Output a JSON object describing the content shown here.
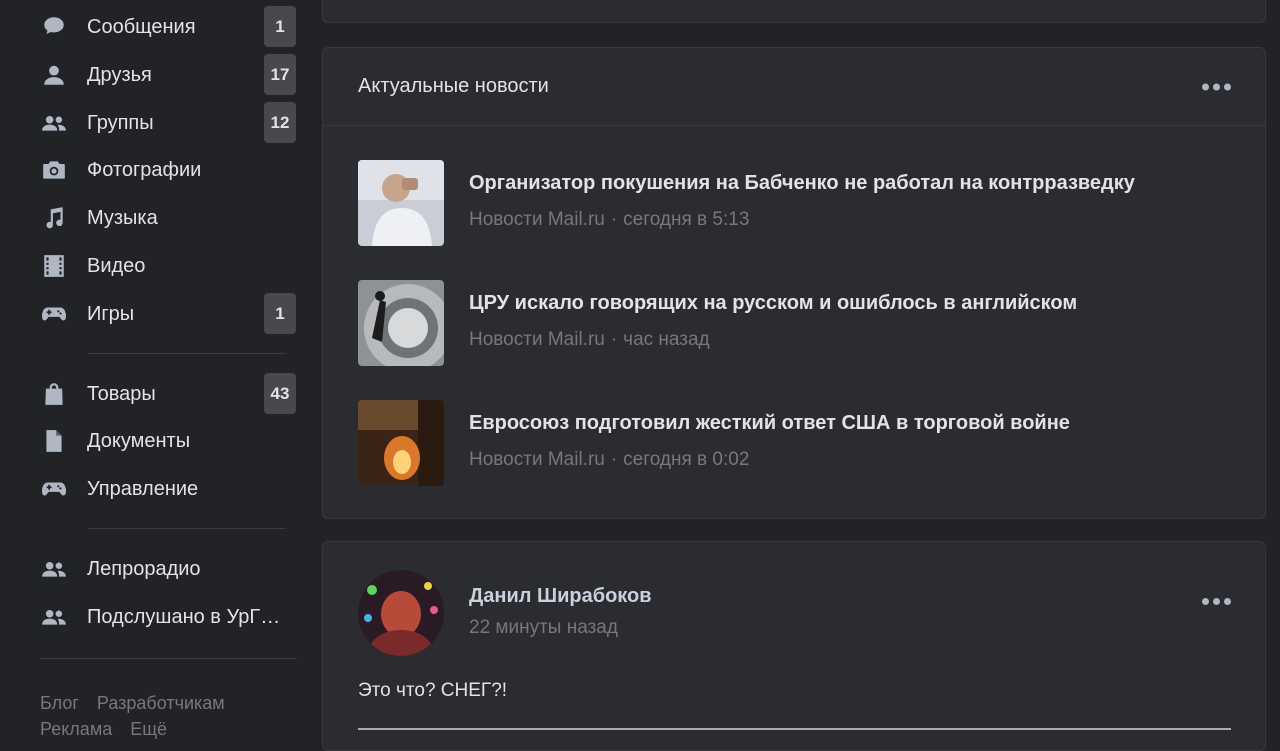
{
  "sidebar": {
    "items": [
      {
        "icon": "message-icon",
        "label": "Сообщения",
        "badge": "1"
      },
      {
        "icon": "user-icon",
        "label": "Друзья",
        "badge": "17"
      },
      {
        "icon": "users-icon",
        "label": "Группы",
        "badge": "12"
      },
      {
        "icon": "camera-icon",
        "label": "Фотографии",
        "badge": ""
      },
      {
        "icon": "music-icon",
        "label": "Музыка",
        "badge": ""
      },
      {
        "icon": "video-icon",
        "label": "Видео",
        "badge": ""
      },
      {
        "icon": "gamepad-icon",
        "label": "Игры",
        "badge": "1"
      },
      {
        "icon": "bag-icon",
        "label": "Товары",
        "badge": "43"
      },
      {
        "icon": "document-icon",
        "label": "Документы",
        "badge": ""
      },
      {
        "icon": "gamepad-icon",
        "label": "Управление",
        "badge": ""
      },
      {
        "icon": "users-icon",
        "label": "Лепрорадио",
        "badge": ""
      },
      {
        "icon": "users-icon",
        "label": "Подслушано в УрГ…",
        "badge": ""
      }
    ],
    "footer": [
      "Блог",
      "Разработчикам",
      "Реклама",
      "Ещё"
    ]
  },
  "news_card": {
    "title": "Актуальные новости",
    "items": [
      {
        "title": "Организатор покушения на Бабченко не работал на контрразведку",
        "source": "Новости Mail.ru",
        "time": "сегодня в 5:13"
      },
      {
        "title": "ЦРУ искало говорящих на русском и ошиблось в английском",
        "source": "Новости Mail.ru",
        "time": "час назад"
      },
      {
        "title": "Евросоюз подготовил жесткий ответ США в торговой войне",
        "source": "Новости Mail.ru",
        "time": "сегодня в 0:02"
      }
    ]
  },
  "post": {
    "author": "Данил Ширабоков",
    "time": "22 минуты назад",
    "text": "Это что? СНЕГ?!"
  },
  "colors": {
    "background": "#222326",
    "card": "#2b2c2f",
    "text": "#e1e3e6",
    "muted": "#76787a",
    "badge": "#48494d"
  }
}
